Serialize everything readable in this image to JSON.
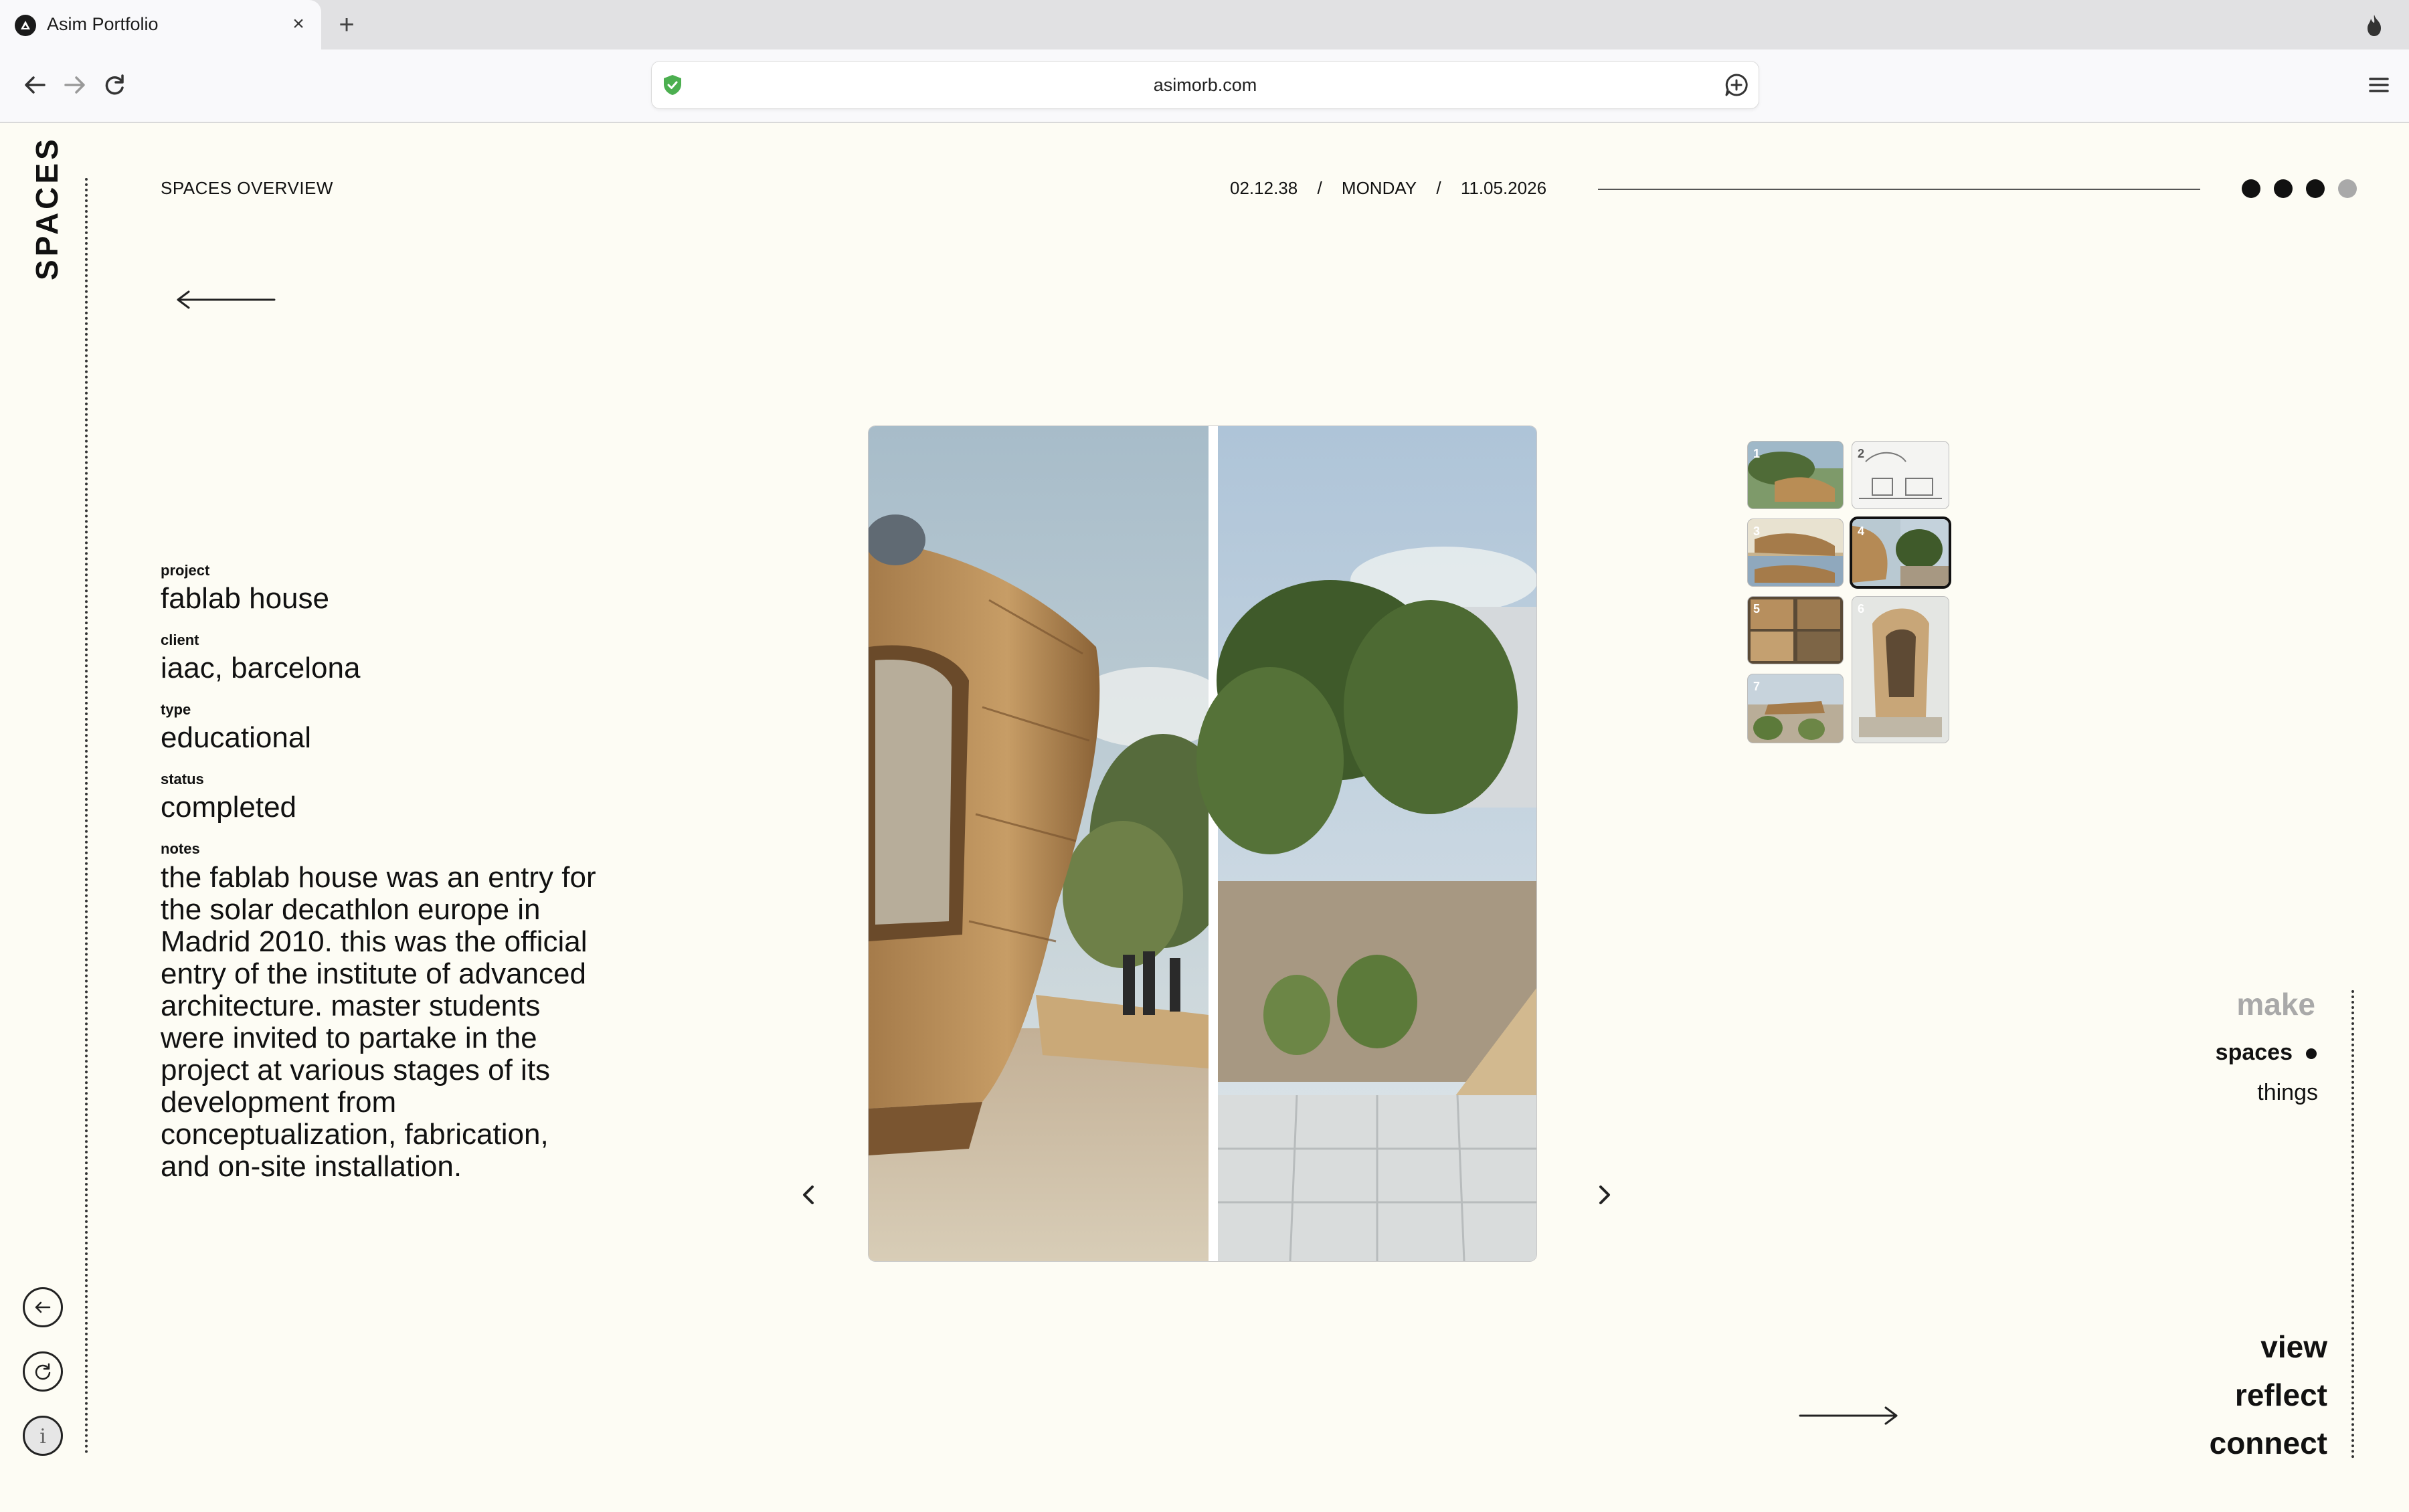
{
  "browser": {
    "tab_title": "Asim Portfolio",
    "tab_close": "×",
    "new_tab": "+",
    "url": "asimorb.com"
  },
  "page": {
    "vertical_title": "SPACES",
    "section_label": "SPACES OVERVIEW",
    "time": "02.12.38",
    "separator": "/",
    "weekday": "MONDAY",
    "date": "11.05.2026",
    "page_indicator": {
      "total": 4,
      "filled": 3
    }
  },
  "project": {
    "labels": {
      "project": "project",
      "client": "client",
      "type": "type",
      "status": "status",
      "notes": "notes"
    },
    "name": "fablab house",
    "client": "iaac, barcelona",
    "type": "educational",
    "status": "completed",
    "notes": "the fablab house was an entry for the solar decathlon europe in Madrid 2010. this was the official entry of the institute of advanced architecture. master students were invited to partake in the project at various stages of its development from conceptualization, fabrication, and on-site installation."
  },
  "gallery": {
    "thumbnails": [
      {
        "number": "1",
        "active": false
      },
      {
        "number": "2",
        "active": false
      },
      {
        "number": "3",
        "active": false
      },
      {
        "number": "4",
        "active": true
      },
      {
        "number": "5",
        "active": false
      },
      {
        "number": "6",
        "active": false
      },
      {
        "number": "7",
        "active": false
      }
    ]
  },
  "categories": {
    "make": "make",
    "spaces": "spaces",
    "things": "things"
  },
  "bottom_nav": {
    "view": "view",
    "reflect": "reflect",
    "connect": "connect"
  },
  "colors": {
    "background": "#fdfcf4",
    "text": "#111111",
    "muted": "#a9a9a9",
    "shield": "#4caf50"
  }
}
